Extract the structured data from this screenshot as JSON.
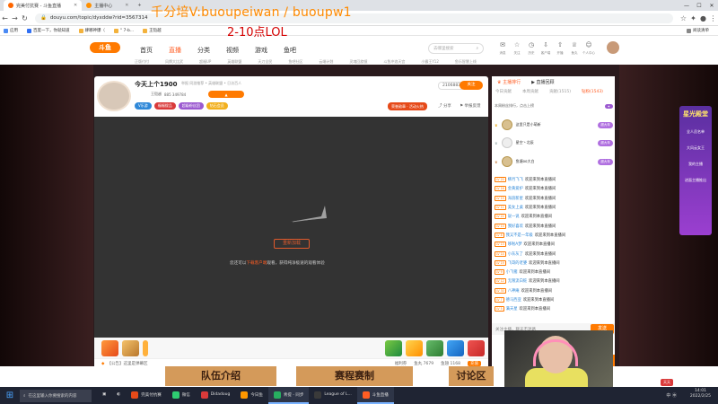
{
  "browser": {
    "tabs": [
      {
        "label": "完美付抗赛 - 斗鱼直播"
      },
      {
        "label": "主播中心"
      }
    ],
    "url": "douyu.com/topic/dyxddw?rid=3567314",
    "window_controls": {
      "min": "—",
      "max": "☐",
      "close": "✕"
    },
    "bookmarks": [
      {
        "label": "应用"
      },
      {
        "label": "百度一下，你就知道"
      },
      {
        "label": "肆哪神爆（"
      },
      {
        "label": "\" 7-b..."
      },
      {
        "label": "王铠越"
      }
    ],
    "reading_list": "阅读清单"
  },
  "overlay": {
    "line1": "千分培V:buoupeiwan / buoupw1",
    "line2": "2-10点LOL"
  },
  "site": {
    "logo": "斗鱼",
    "nav": [
      "首页",
      "直播",
      "分类",
      "视频",
      "游戏",
      "鱼吧"
    ],
    "subnav": [
      "正版付付",
      "风牌大比武",
      "超福UP",
      "英雄联盟",
      "天刀全民",
      "鱼吧社区",
      "云端计划",
      "灵魂回旋镜",
      "斗鱼冲浪天宫",
      "小霸王Y12",
      "鱼乐智慧上线"
    ],
    "search_placeholder": "去哪里搜索",
    "header_icons": [
      {
        "icon": "chat-icon",
        "label": "消息"
      },
      {
        "icon": "star-icon",
        "label": "关注"
      },
      {
        "icon": "history-icon",
        "label": "历史"
      },
      {
        "icon": "download-icon",
        "label": "客户端"
      },
      {
        "icon": "upload-icon",
        "label": "开播"
      },
      {
        "icon": "gift-icon",
        "label": "鱼丸"
      },
      {
        "icon": "user-icon",
        "label": "个人中心"
      }
    ]
  },
  "room": {
    "title": "今天上个1900",
    "meta": "举报  同游推荐 • 英雄联盟 • 日访百人",
    "streamer": "王铠越",
    "stats": "885  349784",
    "follow_label": "关注",
    "follow_count": "2106883",
    "chips": [
      "V乐游",
      "福福搜品",
      "超级粉丝团",
      "钻石会员"
    ],
    "promo": "荣誉勋章 · 活动火热",
    "share": "分享",
    "report": "举报反馈",
    "retry_label": "重新加载",
    "tip_prefix": "您还可以",
    "tip_link": "下载客户端",
    "tip_suffix": "观看，获得纯净极速的观看体验",
    "bottom_bar": "【公告】这里是弹幕区",
    "bottom_stats": [
      "福利券",
      "鱼丸 7679",
      "鱼翅 1168",
      "充值"
    ]
  },
  "panel": {
    "tabs": [
      "主播排行",
      "直播回顾"
    ],
    "subtabs": [
      "今日贡献",
      "本周贡献",
      "贡献(1515)",
      "钻粉(1543)"
    ],
    "header": "本周粉丝排行，点击上榜",
    "ranks": [
      {
        "name": "这里只是小萌新",
        "badge": "超大年"
      },
      {
        "name": "星空丶北辰",
        "badge": "超大年"
      },
      {
        "name": "鱼塘oo大白",
        "badge": "超大年"
      }
    ],
    "chat": [
      {
        "lv": "LV 20",
        "name": "柳月飞飞",
        "msg": "欢迎来到本直播间"
      },
      {
        "lv": "LV 16",
        "name": "金黄爱护",
        "msg": "欢迎来到本直播间"
      },
      {
        "lv": "LV 15",
        "name": "海浪新星",
        "msg": "欢迎来到本直播间"
      },
      {
        "lv": "LV 11",
        "name": "美女上桌",
        "msg": "欢迎来到本直播间"
      },
      {
        "lv": "LV 22",
        "name": "说一说",
        "msg": "欢迎来到本直播间"
      },
      {
        "lv": "LV 10",
        "name": "我好喜欢",
        "msg": "欢迎来到本直播间"
      },
      {
        "lv": "LV 8",
        "name": "我又不是一年级",
        "msg": "欢迎来到本直播间"
      },
      {
        "lv": "LV 13",
        "name": "哆啦A梦",
        "msg": "欢迎来到本直播间"
      },
      {
        "lv": "LV 14",
        "name": "小灰灰了",
        "msg": "欢迎来到本直播间"
      },
      {
        "lv": "LV 19",
        "name": "飞哥的老婆",
        "msg": "欢迎来到本直播间"
      },
      {
        "lv": "LV 9",
        "name": "小飞猪",
        "msg": "欢迎来到本直播间"
      },
      {
        "lv": "LV 12",
        "name": "无限流白蛇",
        "msg": "欢迎来到本直播间"
      },
      {
        "lv": "LV 30",
        "name": "八神庵",
        "msg": "欢迎来到本直播间"
      },
      {
        "lv": "LV 7",
        "name": "德马西亚",
        "msg": "欢迎来到本直播间"
      },
      {
        "lv": "LV 5",
        "name": "满天星",
        "msg": "欢迎来到本直播间"
      }
    ],
    "input_placeholder": "关注主播，聊天不迷路",
    "send_label": "发送",
    "send2_label": "发送"
  },
  "sidead": {
    "title": "星光殿堂",
    "items": [
      "全人员名单",
      "大风云女王",
      "我的主播",
      "进面主播推出"
    ]
  },
  "banners": [
    "队伍介绍",
    "赛程赛制",
    "讨论区"
  ],
  "taskbar": {
    "search": "在这里输入你要搜索的内容",
    "items": [
      {
        "label": "完美付抗赛",
        "color": "#e64a19"
      },
      {
        "label": "微信",
        "color": "#2ecc71"
      },
      {
        "label": "Didadoug",
        "color": "#d93a3a"
      },
      {
        "label": "今日鱼",
        "color": "#ff9800"
      },
      {
        "label": "青提 - 同步",
        "color": "#27ae60"
      },
      {
        "label": "League of L...",
        "color": "#3a3a3a"
      },
      {
        "label": "斗鱼直播",
        "color": "#ff5d23"
      }
    ],
    "tray": "中 ㊥",
    "time": "14:01",
    "date": "2022/2/25",
    "tray_badge": "天天"
  }
}
